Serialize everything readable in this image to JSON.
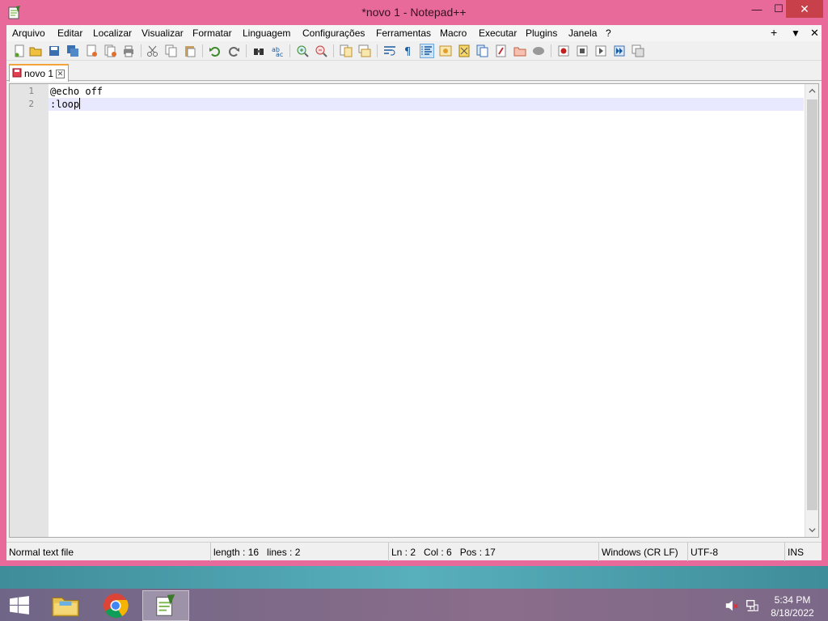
{
  "window": {
    "title": "*novo 1 - Notepad++",
    "controls": {
      "minimize": "—",
      "maximize": "☐",
      "close": "✕"
    }
  },
  "menu": {
    "items": [
      "Arquivo",
      "Editar",
      "Localizar",
      "Visualizar",
      "Formatar",
      "Linguagem",
      "Configurações",
      "Ferramentas",
      "Macro",
      "Executar",
      "Plugins",
      "Janela",
      "?"
    ],
    "right": {
      "plus": "+",
      "dropdown": "▼",
      "close": "✕"
    }
  },
  "tabs": [
    {
      "label": "novo 1",
      "close": "✕",
      "modified": true
    }
  ],
  "editor": {
    "lines": [
      {
        "number": "1",
        "text": "@echo off"
      },
      {
        "number": "2",
        "text": ":loop"
      }
    ],
    "current_line": 2
  },
  "status": {
    "file_type": "Normal text file",
    "length": "length : 16",
    "lines": "lines : 2",
    "ln": "Ln : 2",
    "col": "Col : 6",
    "pos": "Pos : 17",
    "eol": "Windows (CR LF)",
    "encoding": "UTF-8",
    "mode": "INS"
  },
  "taskbar": {
    "clock_time": "5:34 PM",
    "clock_date": "8/18/2022"
  },
  "colors": {
    "window_frame": "#e86a9a",
    "close_button": "#c7404a",
    "current_line": "#e8e8ff",
    "tab_accent": "#f3a53b"
  }
}
